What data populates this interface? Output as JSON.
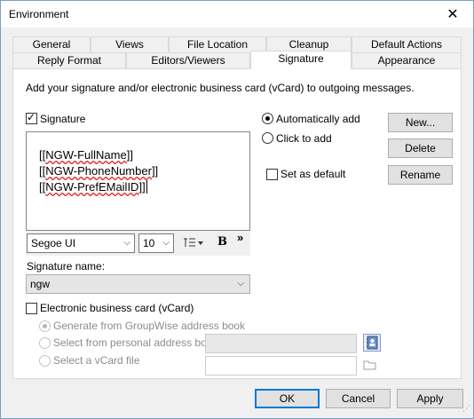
{
  "window": {
    "title": "Environment",
    "close_glyph": "✕"
  },
  "tabs_row1": [
    {
      "label": "General"
    },
    {
      "label": "Views"
    },
    {
      "label": "File Location"
    },
    {
      "label": "Cleanup"
    },
    {
      "label": "Default Actions"
    }
  ],
  "tabs_row2": [
    {
      "label": "Reply Format"
    },
    {
      "label": "Editors/Viewers"
    },
    {
      "label": "Signature"
    },
    {
      "label": "Appearance"
    }
  ],
  "active_tab": "Signature",
  "signature_panel": {
    "description": "Add your signature and/or electronic business card (vCard) to outgoing messages.",
    "signature_checkbox": {
      "label": "Signature",
      "checked": true
    },
    "editor_lines": [
      "[[NGW-FullName]]",
      "[[NGW-PhoneNumber]]",
      "[[NGW-PrefEMailID]]"
    ],
    "editor_line_parts": [
      {
        "pre": "[[",
        "word": "NGW-FullName",
        "post": "]]"
      },
      {
        "pre": "[[",
        "word": "NGW-PhoneNumber",
        "post": "]]"
      },
      {
        "pre": "[[",
        "word": "NGW-PrefEMailID",
        "post": "]]"
      }
    ],
    "font_select": "Segoe UI",
    "size_select": "10",
    "bold_label": "B",
    "more_glyph": "»",
    "signature_name_label": "Signature name:",
    "signature_name_value": "ngw",
    "auto_add": {
      "label": "Automatically add",
      "checked": true
    },
    "click_to_add": {
      "label": "Click to add",
      "checked": false
    },
    "set_default": {
      "label": "Set as default",
      "checked": false
    },
    "buttons": {
      "new": "New...",
      "delete": "Delete",
      "rename": "Rename"
    },
    "vcard": {
      "label": "Electronic business card (vCard)",
      "checked": false,
      "options": [
        {
          "label": "Generate from GroupWise address book",
          "checked": true
        },
        {
          "label": "Select from personal address book",
          "checked": false
        },
        {
          "label": "Select a vCard file",
          "checked": false
        }
      ]
    }
  },
  "footer": {
    "ok": "OK",
    "cancel": "Cancel",
    "apply": "Apply"
  },
  "colors": {
    "accent": "#0078d7",
    "squiggle": "#e02020"
  },
  "icons": [
    "close-icon",
    "chevron-down-icon",
    "list-format-icon",
    "address-book-icon",
    "folder-icon"
  ]
}
